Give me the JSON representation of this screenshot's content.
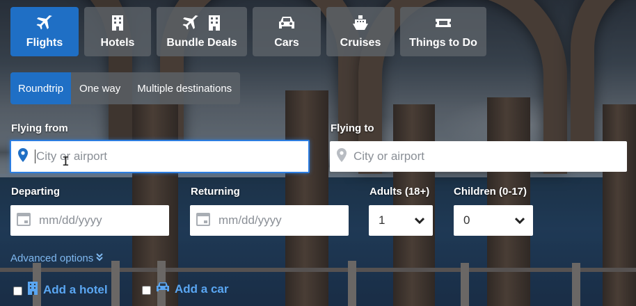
{
  "product_tabs": [
    {
      "label": "Flights",
      "icon": "airplane-icon",
      "active": true
    },
    {
      "label": "Hotels",
      "icon": "building-icon",
      "active": false
    },
    {
      "label": "Bundle Deals",
      "icon": "airplane-building-icon",
      "active": false
    },
    {
      "label": "Cars",
      "icon": "car-icon",
      "active": false
    },
    {
      "label": "Cruises",
      "icon": "ship-icon",
      "active": false
    },
    {
      "label": "Things to Do",
      "icon": "ticket-icon",
      "active": false
    }
  ],
  "trip_types": [
    {
      "label": "Roundtrip",
      "active": true
    },
    {
      "label": "One way",
      "active": false
    },
    {
      "label": "Multiple destinations",
      "active": false
    }
  ],
  "flying_from": {
    "label": "Flying from",
    "placeholder": "City or airport",
    "value": ""
  },
  "flying_to": {
    "label": "Flying to",
    "placeholder": "City or airport",
    "value": ""
  },
  "departing": {
    "label": "Departing",
    "placeholder": "mm/dd/yyyy"
  },
  "returning": {
    "label": "Returning",
    "placeholder": "mm/dd/yyyy"
  },
  "adults": {
    "label": "Adults (18+)",
    "value": "1"
  },
  "children": {
    "label": "Children (0-17)",
    "value": "0"
  },
  "advanced_options": "Advanced options",
  "add_hotel": "Add a hotel",
  "add_car": "Add a car",
  "colors": {
    "accent": "#1f6fc5",
    "tab_bg": "#5c6168",
    "link": "#5aa6f2"
  }
}
